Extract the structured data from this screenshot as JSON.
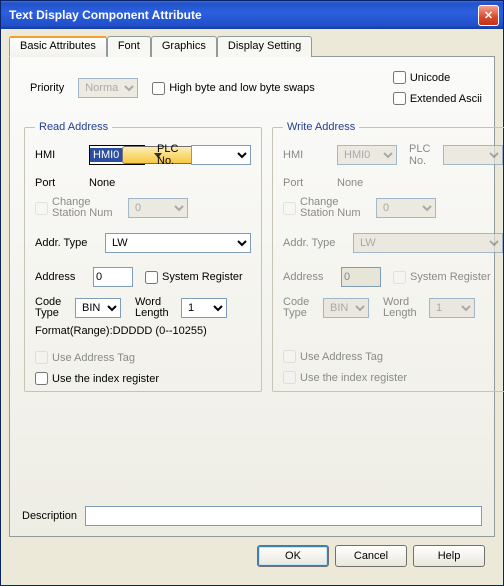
{
  "window": {
    "title": "Text Display Component Attribute"
  },
  "tabs": [
    "Basic Attributes",
    "Font",
    "Graphics",
    "Display Setting"
  ],
  "priority": {
    "label": "Priority",
    "value": "Normal",
    "swap_label": "High byte and low byte swaps",
    "unicode_label": "Unicode",
    "ext_ascii_label": "Extended Ascii"
  },
  "read": {
    "legend": "Read Address",
    "hmi_label": "HMI",
    "hmi_value": "HMI0",
    "plc_label": "PLC No.",
    "plc_value": "",
    "port_label": "Port",
    "port_value": "None",
    "change_station_label": "Change Station Num",
    "change_station_value": "0",
    "addr_type_label": "Addr. Type",
    "addr_type_value": "LW",
    "address_label": "Address",
    "address_value": "0",
    "system_register_label": "System Register",
    "code_type_label": "Code Type",
    "code_type_value": "BIN",
    "word_length_label": "Word Length",
    "word_length_value": "1",
    "format_label": "Format(Range):DDDDD (0--10255)",
    "use_addr_tag_label": "Use Address Tag",
    "use_index_reg_label": "Use the index register"
  },
  "write": {
    "legend": "Write Address",
    "hmi_label": "HMI",
    "hmi_value": "HMI0",
    "plc_label": "PLC No.",
    "plc_value": "",
    "port_label": "Port",
    "port_value": "None",
    "change_station_label": "Change Station Num",
    "change_station_value": "0",
    "addr_type_label": "Addr. Type",
    "addr_type_value": "LW",
    "address_label": "Address",
    "address_value": "0",
    "system_register_label": "System Register",
    "code_type_label": "Code Type",
    "code_type_value": "BIN",
    "word_length_label": "Word Length",
    "word_length_value": "1",
    "use_addr_tag_label": "Use Address Tag",
    "use_index_reg_label": "Use the index register"
  },
  "description": {
    "label": "Description",
    "value": ""
  },
  "buttons": {
    "ok": "OK",
    "cancel": "Cancel",
    "help": "Help"
  }
}
